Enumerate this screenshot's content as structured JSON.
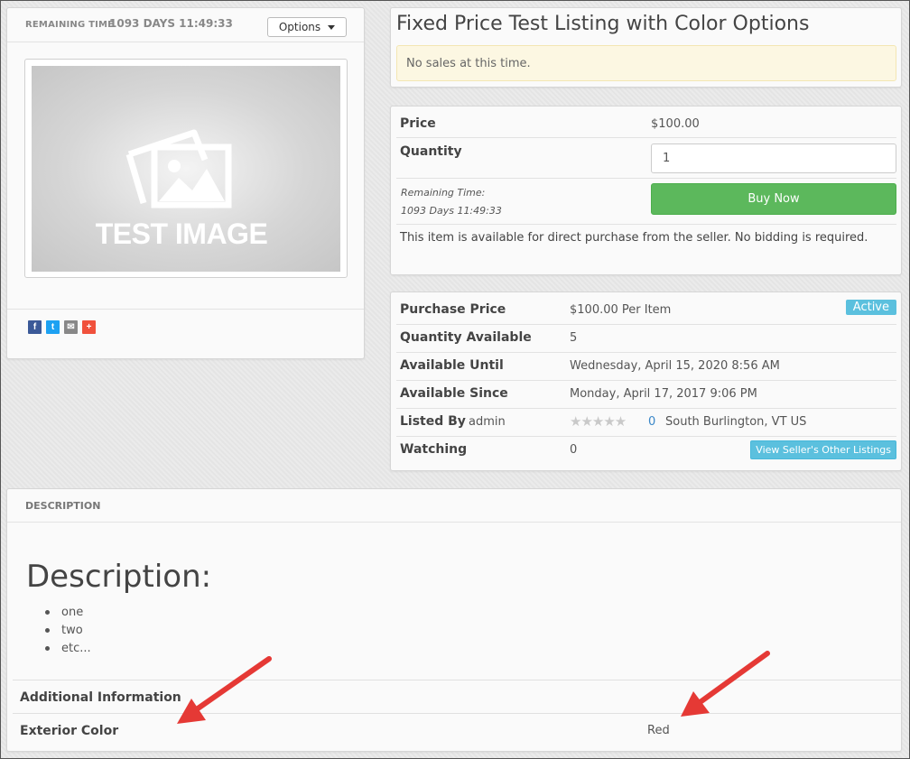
{
  "left_panel": {
    "remaining_label": "REMAINING TIME",
    "remaining_value": "1093 DAYS 11:49:33",
    "options_label": "Options",
    "image_text": "TEST IMAGE",
    "share_icons": [
      "facebook-icon",
      "twitter-icon",
      "email-icon",
      "plus-share-icon"
    ]
  },
  "title_panel": {
    "title": "Fixed Price Test Listing with Color Options",
    "alert": "No sales at this time."
  },
  "price_panel": {
    "price_label": "Price",
    "price_value": "$100.00",
    "quantity_label": "Quantity",
    "quantity_value": "1",
    "remaining_label": "Remaining Time:",
    "remaining_value": "1093 Days 11:49:33",
    "buy_label": "Buy Now",
    "note": "This item is available for direct purchase from the seller. No bidding is required."
  },
  "details_panel": {
    "purchase_price_label": "Purchase Price",
    "purchase_price_value": "$100.00 Per Item",
    "status_badge": "Active",
    "qty_available_label": "Quantity Available",
    "qty_available_value": "5",
    "available_until_label": "Available Until",
    "available_until_value": "Wednesday, April 15, 2020 8:56 AM",
    "available_since_label": "Available Since",
    "available_since_value": "Monday, April 17, 2017 9:06 PM",
    "listed_by_label": "Listed By",
    "listed_by_value": "admin",
    "rating_stars": "★★★★★",
    "rating_count": "0",
    "location": "South Burlington, VT US",
    "watching_label": "Watching",
    "watching_value": "0",
    "seller_listings_label": "View Seller's Other Listings"
  },
  "description": {
    "header": "DESCRIPTION",
    "title": "Description:",
    "items": [
      "one",
      "two",
      "etc..."
    ],
    "additional_info_label": "Additional Information",
    "exterior_color_label": "Exterior Color",
    "exterior_color_value": "Red"
  },
  "colors": {
    "buy_button": "#5cb85c",
    "info_badge": "#5bc0de",
    "arrow": "#e53935"
  }
}
